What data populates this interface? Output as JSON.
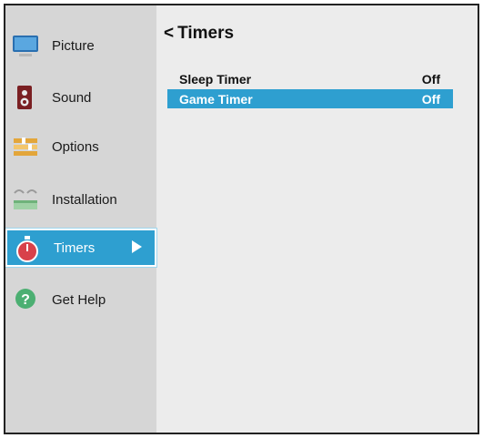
{
  "sidebar": {
    "items": [
      {
        "label": "Picture",
        "icon": "monitor-icon"
      },
      {
        "label": "Sound",
        "icon": "speaker-icon"
      },
      {
        "label": "Options",
        "icon": "options-icon"
      },
      {
        "label": "Installation",
        "icon": "installation-icon"
      },
      {
        "label": "Timers",
        "icon": "stopwatch-icon",
        "active": true
      },
      {
        "label": "Get Help",
        "icon": "help-icon"
      }
    ]
  },
  "main": {
    "title": "Timers",
    "rows": [
      {
        "label": "Sleep Timer",
        "value": "Off"
      },
      {
        "label": "Game Timer",
        "value": "Off",
        "selected": true
      }
    ]
  },
  "colors": {
    "accent": "#2e9fd0",
    "sidebar": "#d6d6d6",
    "panel": "#ececec"
  }
}
